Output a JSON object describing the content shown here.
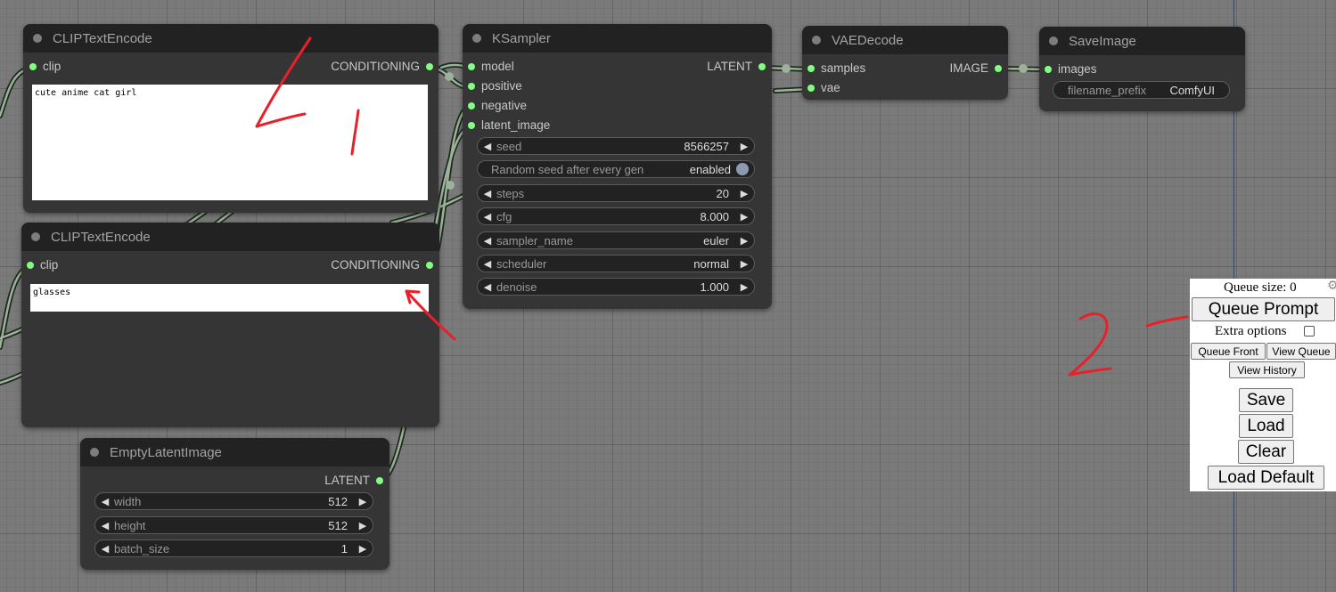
{
  "nodes": {
    "clip1": {
      "title": "CLIPTextEncode",
      "input_clip": "clip",
      "output": "CONDITIONING",
      "text": "cute anime cat girl"
    },
    "clip2": {
      "title": "CLIPTextEncode",
      "input_clip": "clip",
      "output": "CONDITIONING",
      "text": "glasses"
    },
    "ksampler": {
      "title": "KSampler",
      "inputs": [
        "model",
        "positive",
        "negative",
        "latent_image"
      ],
      "output": "LATENT",
      "seed": {
        "label": "seed",
        "value": "8566257"
      },
      "random_seed": {
        "label": "Random seed after every gen",
        "value": "enabled"
      },
      "steps": {
        "label": "steps",
        "value": "20"
      },
      "cfg": {
        "label": "cfg",
        "value": "8.000"
      },
      "sampler_name": {
        "label": "sampler_name",
        "value": "euler"
      },
      "scheduler": {
        "label": "scheduler",
        "value": "normal"
      },
      "denoise": {
        "label": "denoise",
        "value": "1.000"
      }
    },
    "vaedecode": {
      "title": "VAEDecode",
      "inputs": [
        "samples",
        "vae"
      ],
      "output": "IMAGE"
    },
    "saveimage": {
      "title": "SaveImage",
      "input": "images",
      "filename_prefix": {
        "label": "filename_prefix",
        "value": "ComfyUI"
      }
    },
    "emptylatent": {
      "title": "EmptyLatentImage",
      "output": "LATENT",
      "width": {
        "label": "width",
        "value": "512"
      },
      "height": {
        "label": "height",
        "value": "512"
      },
      "batch_size": {
        "label": "batch_size",
        "value": "1"
      }
    }
  },
  "menu": {
    "queue_size": "Queue size: 0",
    "queue_prompt": "Queue Prompt",
    "extra_options": "Extra options",
    "queue_front": "Queue Front",
    "view_queue": "View Queue",
    "view_history": "View History",
    "save": "Save",
    "load": "Load",
    "clear": "Clear",
    "load_default": "Load Default"
  },
  "colors": {
    "slot": "#80ff80",
    "node_bg": "#353535",
    "title_bg": "#222222",
    "annotation": "#e8202a"
  },
  "icons": {
    "arrow_left": "◀",
    "arrow_right": "▶",
    "settings": "⚙"
  }
}
